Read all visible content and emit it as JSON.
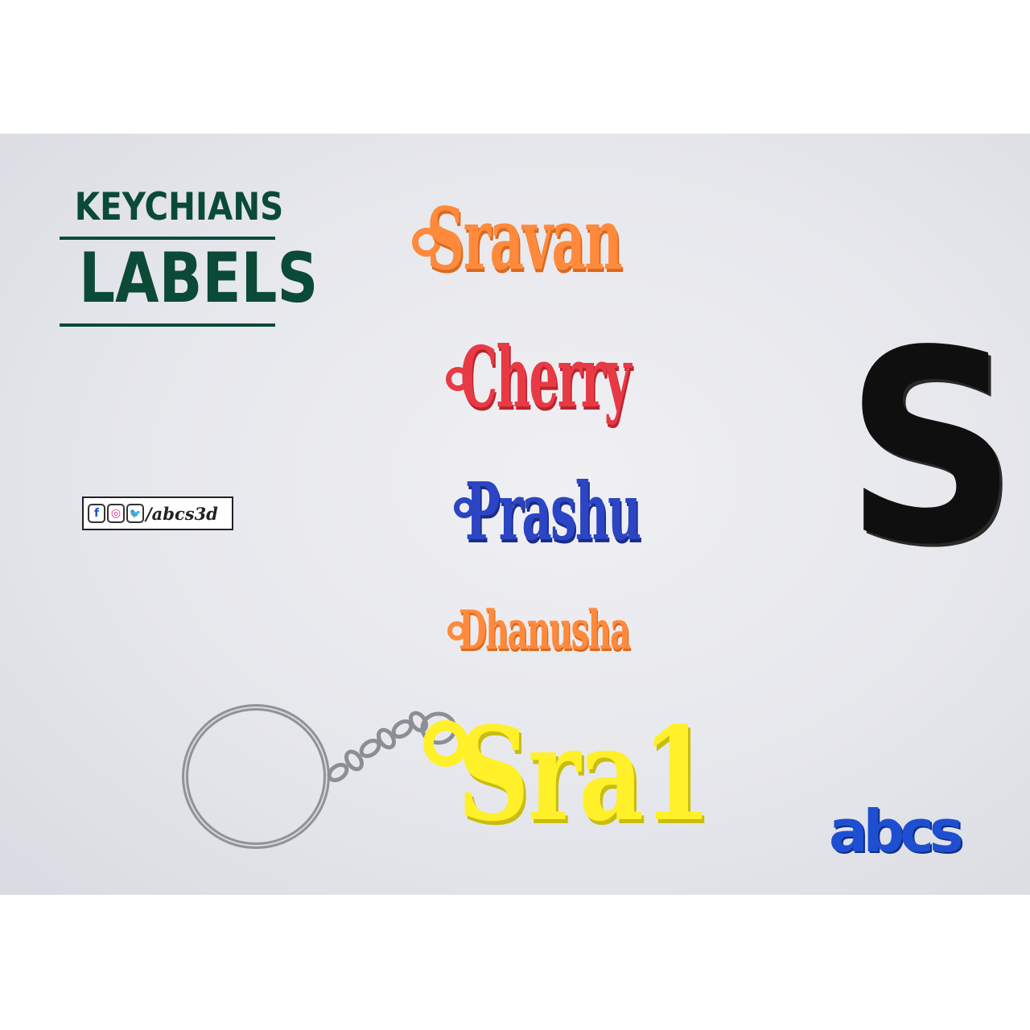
{
  "heading": {
    "line1": "KEYCHIANS",
    "line2": "LABELS"
  },
  "social": {
    "handle": "/abcs3d",
    "icons": [
      "facebook-icon",
      "instagram-icon",
      "twitter-icon"
    ],
    "glyphs": {
      "facebook": "f",
      "instagram": "◎",
      "twitter": "🐦"
    }
  },
  "tags": [
    {
      "text": "Sravan",
      "color": "#ff8a3c"
    },
    {
      "text": "Cherry",
      "color": "#e83a45"
    },
    {
      "text": "Prashu",
      "color": "#2b45c4"
    },
    {
      "text": "Dhanusha",
      "color": "#ff8a3c"
    },
    {
      "text": "Sra1",
      "color": "#fff02a"
    }
  ],
  "letter": {
    "text": "S",
    "color": "#0f0f10"
  },
  "logo": {
    "text": "abcs"
  },
  "colors": {
    "heading": "#0b4a36",
    "background": "#e6e7ec",
    "logo": "#1e4fd0"
  }
}
